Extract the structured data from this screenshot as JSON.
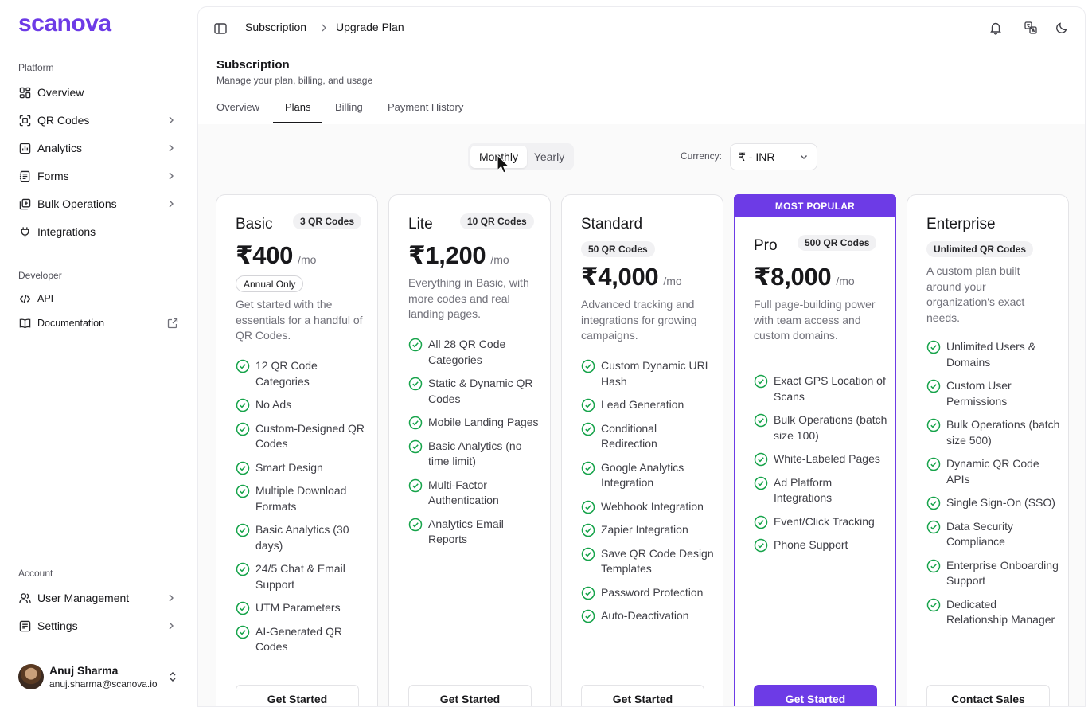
{
  "brand": {
    "name": "scanova",
    "accent": "#6d3be6"
  },
  "sidebar": {
    "platform_label": "Platform",
    "developer_label": "Developer",
    "account_label": "Account",
    "items": [
      {
        "label": "Overview",
        "icon": "dashboard-icon"
      },
      {
        "label": "QR Codes",
        "icon": "qr-scan-icon"
      },
      {
        "label": "Analytics",
        "icon": "bar-chart-icon"
      },
      {
        "label": "Forms",
        "icon": "form-icon"
      },
      {
        "label": "Bulk Operations",
        "icon": "stack-icon"
      },
      {
        "label": "Integrations",
        "icon": "plug-icon"
      }
    ],
    "dev_items": [
      {
        "label": "API",
        "icon": "code-icon"
      },
      {
        "label": "Documentation",
        "icon": "book-icon"
      }
    ],
    "account_items": [
      {
        "label": "User Management",
        "icon": "users-icon"
      },
      {
        "label": "Settings",
        "icon": "settings-icon"
      }
    ],
    "user": {
      "name": "Anuj Sharma",
      "email": "anuj.sharma@scanova.io"
    }
  },
  "header": {
    "breadcrumb": [
      "Subscription",
      "Upgrade Plan"
    ]
  },
  "page": {
    "title": "Subscription",
    "subtitle": "Manage your plan, billing, and usage"
  },
  "tabs": [
    "Overview",
    "Plans",
    "Billing",
    "Payment History"
  ],
  "active_tab": "Plans",
  "billing_period": {
    "options": [
      "Monthly",
      "Yearly"
    ],
    "selected": "Monthly"
  },
  "currency": {
    "label": "Currency:",
    "value": "₹ - INR"
  },
  "plans": [
    {
      "name": "Basic",
      "badge": "3 QR Codes",
      "price": "₹400",
      "per": "/mo",
      "note": "Annual Only",
      "desc": "Get started with the essentials for a handful of QR Codes.",
      "features": [
        "12 QR Code Categories",
        "No Ads",
        "Custom-Designed QR Codes",
        "Smart Design",
        "Multiple Download Formats",
        "Basic Analytics (30 days)",
        "24/5 Chat & Email Support",
        "UTM Parameters",
        "AI-Generated QR Codes"
      ],
      "cta": "Get Started"
    },
    {
      "name": "Lite",
      "badge": "10 QR Codes",
      "price": "₹1,200",
      "per": "/mo",
      "desc": "Everything in Basic, with more codes and real landing pages.",
      "features": [
        "All 28 QR Code Categories",
        "Static & Dynamic QR Codes",
        "Mobile Landing Pages",
        "Basic Analytics (no time limit)",
        "Multi-Factor Authentication",
        "Analytics Email Reports"
      ],
      "cta": "Get Started"
    },
    {
      "name": "Standard",
      "badge": "50 QR Codes",
      "price": "₹4,000",
      "per": "/mo",
      "desc": "Advanced tracking and integrations for growing campaigns.",
      "features": [
        "Custom Dynamic URL Hash",
        "Lead Generation",
        "Conditional Redirection",
        "Google Analytics Integration",
        "Webhook Integration",
        "Zapier Integration",
        "Save QR Code Design Templates",
        "Password Protection",
        "Auto-Deactivation"
      ],
      "cta": "Get Started"
    },
    {
      "name": "Pro",
      "badge": "500 QR Codes",
      "price": "₹8,000",
      "per": "/mo",
      "ribbon": "MOST POPULAR",
      "desc": "Full page-building power with team access and custom domains.",
      "features": [
        "Exact GPS Location of Scans",
        "Bulk Operations (batch size 100)",
        "White-Labeled Pages",
        "Ad Platform Integrations",
        "Event/Click Tracking",
        "Phone Support"
      ],
      "cta": "Get Started"
    },
    {
      "name": "Enterprise",
      "badge": "Unlimited QR Codes",
      "desc": "A custom plan built around your organization's exact needs.",
      "features": [
        "Unlimited Users & Domains",
        "Custom User Permissions",
        "Bulk Operations (batch size 500)",
        "Dynamic QR Code APIs",
        "Single Sign-On (SSO)",
        "Data Security Compliance",
        "Enterprise Onboarding Support",
        "Dedicated Relationship Manager"
      ],
      "cta": "Contact Sales"
    }
  ]
}
